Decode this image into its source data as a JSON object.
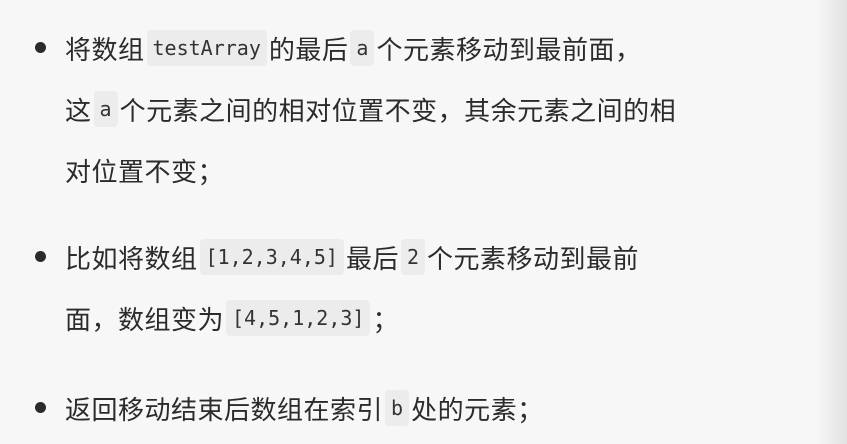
{
  "items": [
    {
      "lines": [
        [
          {
            "type": "text",
            "value": "将数组"
          },
          {
            "type": "code",
            "value": "testArray"
          },
          {
            "type": "text",
            "value": "的最后"
          },
          {
            "type": "code",
            "value": "a"
          },
          {
            "type": "text",
            "value": "个元素移动到最前面，"
          }
        ],
        [
          {
            "type": "text",
            "value": "这"
          },
          {
            "type": "code",
            "value": "a"
          },
          {
            "type": "text",
            "value": "个元素之间的相对位置不变，其余元素之间的相"
          }
        ],
        [
          {
            "type": "text",
            "value": "对位置不变；"
          }
        ]
      ]
    },
    {
      "lines": [
        [
          {
            "type": "text",
            "value": "比如将数组"
          },
          {
            "type": "code",
            "value": "[1,2,3,4,5]"
          },
          {
            "type": "text",
            "value": "最后"
          },
          {
            "type": "code",
            "value": "2"
          },
          {
            "type": "text",
            "value": "个元素移动到最前"
          }
        ],
        [
          {
            "type": "text",
            "value": "面，数组变为"
          },
          {
            "type": "code",
            "value": "[4,5,1,2,3]"
          },
          {
            "type": "text",
            "value": "；"
          }
        ]
      ]
    },
    {
      "lines": [
        [
          {
            "type": "text",
            "value": "返回移动结束后数组在索引"
          },
          {
            "type": "code",
            "value": "b"
          },
          {
            "type": "text",
            "value": "处的元素；"
          }
        ]
      ]
    }
  ]
}
